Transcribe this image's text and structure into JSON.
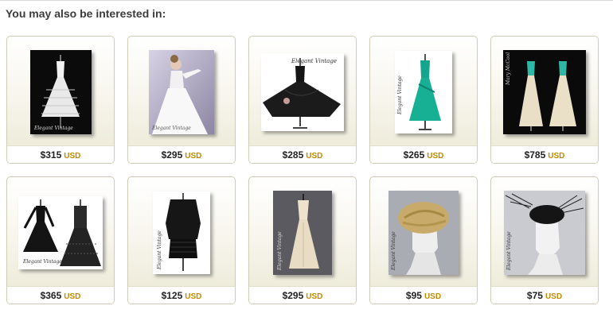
{
  "section_heading": "You may also be interested in:",
  "products": [
    {
      "price": "$315",
      "currency": "USD",
      "icon": "white-tiered-cocktail-dress"
    },
    {
      "price": "$295",
      "currency": "USD",
      "icon": "white-ballgown-model"
    },
    {
      "price": "$285",
      "currency": "USD",
      "icon": "black-swing-dress"
    },
    {
      "price": "$265",
      "currency": "USD",
      "icon": "teal-gown"
    },
    {
      "price": "$785",
      "currency": "USD",
      "icon": "ivory-gowns-teal-sash"
    },
    {
      "price": "$365",
      "currency": "USD",
      "icon": "black-lace-dress-pair"
    },
    {
      "price": "$125",
      "currency": "USD",
      "icon": "black-drop-waist-dress"
    },
    {
      "price": "$295",
      "currency": "USD",
      "icon": "ivory-evening-gown"
    },
    {
      "price": "$95",
      "currency": "USD",
      "icon": "gold-turban-hat"
    },
    {
      "price": "$75",
      "currency": "USD",
      "icon": "black-feather-hat"
    }
  ]
}
